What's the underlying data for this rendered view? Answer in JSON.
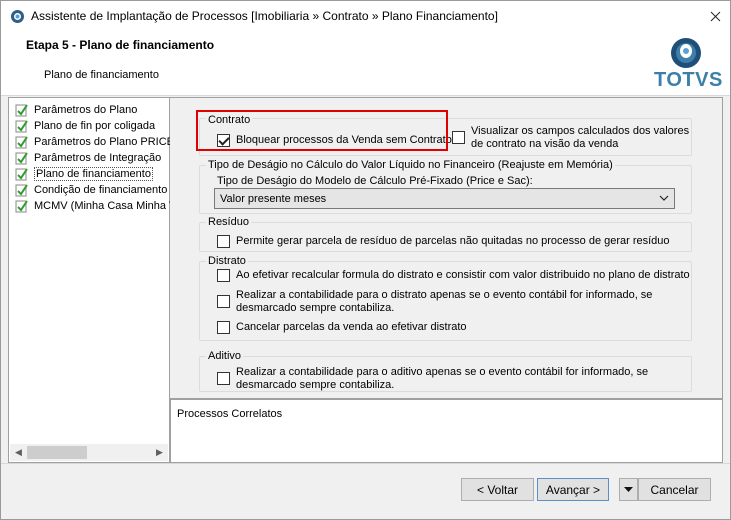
{
  "window": {
    "title": "Assistente de Implantação de Processos [Imobiliaria » Contrato » Plano Financiamento]"
  },
  "header": {
    "step_title": "Etapa 5 - Plano de financiamento",
    "step_subtitle": "Plano de financiamento",
    "logo_text": "TOTVS"
  },
  "tree": {
    "items": [
      {
        "label": "Parâmetros do Plano"
      },
      {
        "label": "Plano de fin por coligada"
      },
      {
        "label": "Parâmetros do Plano PRICE"
      },
      {
        "label": "Parâmetros de Integração"
      },
      {
        "label": "Plano de financiamento"
      },
      {
        "label": "Condição de financiamento"
      },
      {
        "label": "MCMV (Minha Casa Minha Vi"
      }
    ],
    "selected_index": 4
  },
  "contrato": {
    "group_label": "Contrato",
    "bloquear_label": "Bloquear processos da Venda sem Contrato",
    "bloquear_checked": true,
    "visualizar_label": "Visualizar os campos calculados dos valores de contrato na visão da venda",
    "visualizar_checked": false
  },
  "desagio": {
    "group_label": "Tipo de Deságio no Cálculo do Valor Líquido no Financeiro (Reajuste em Memória)",
    "field_label": "Tipo de Deságio do Modelo de Cálculo Pré-Fixado (Price e Sac):",
    "selected_value": "Valor presente meses"
  },
  "residuo": {
    "group_label": "Resíduo",
    "option_label": "Permite gerar parcela de resíduo de parcelas não quitadas no processo de gerar resíduo",
    "option_checked": false
  },
  "distrato": {
    "group_label": "Distrato",
    "options": [
      {
        "label": "Ao efetivar recalcular formula do distrato e consistir com valor distribuido no plano de distrato",
        "checked": false
      },
      {
        "label": "Realizar a contabilidade para o distrato apenas se o evento contábil for informado, se desmarcado sempre contabiliza.",
        "checked": false
      },
      {
        "label": "Cancelar parcelas da venda ao efetivar distrato",
        "checked": false
      }
    ]
  },
  "aditivo": {
    "group_label": "Aditivo",
    "option_label": "Realizar a contabilidade para o aditivo apenas se o evento contábil for informado, se desmarcado sempre contabiliza.",
    "option_checked": false
  },
  "related": {
    "label": "Processos Correlatos"
  },
  "footer": {
    "back_label": "< Voltar",
    "next_label": "Avançar >",
    "cancel_label": "Cancelar"
  },
  "colors": {
    "logo_blue": "#3d7fa8",
    "highlight_red": "#e00000",
    "check_green": "#2e9e2e"
  }
}
